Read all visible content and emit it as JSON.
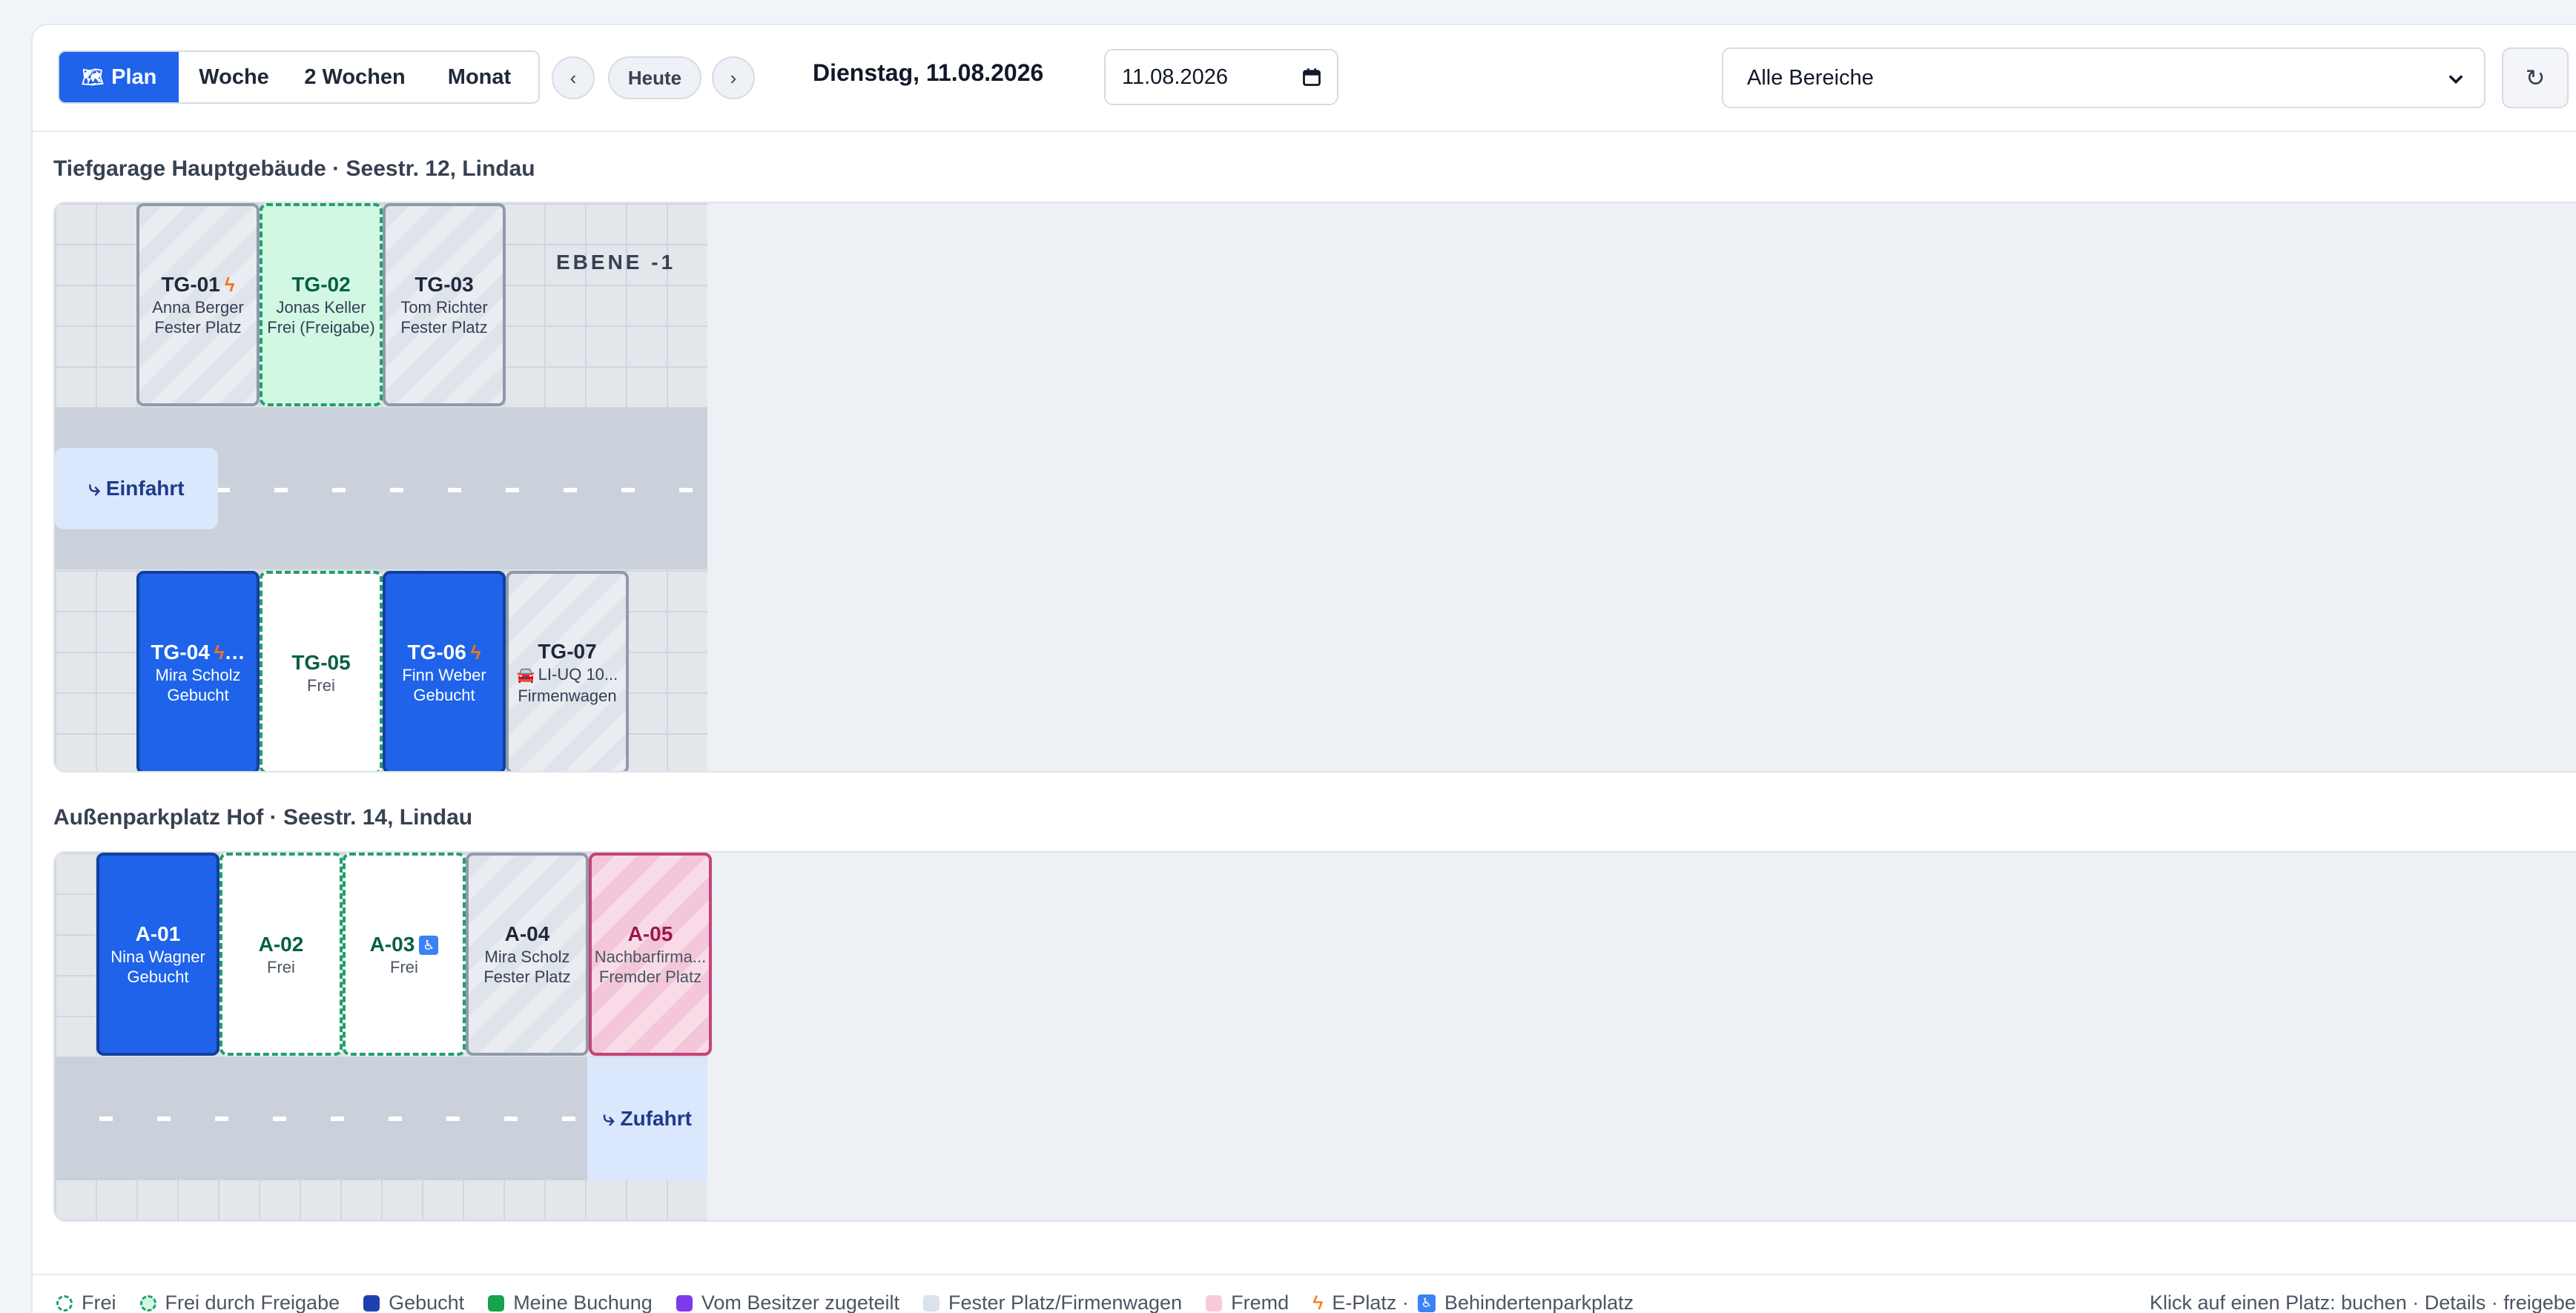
{
  "toolbar": {
    "views": [
      "Plan",
      "Woche",
      "2 Wochen",
      "Monat"
    ],
    "prev_label": "‹",
    "today_label": "Heute",
    "next_label": "›",
    "date_heading": "Dienstag, 11.08.2026",
    "date_value": "11.08.2026",
    "area_filter": "Alle Bereiche",
    "refresh_label": "↻"
  },
  "areas": [
    {
      "title": "Tiefgarage Hauptgebäude · Seestr. 12, Lindau",
      "level": "EBENE -1",
      "gate": "⤷ Einfahrt",
      "spots": [
        {
          "id": "TG-01",
          "line1": "Anna Berger",
          "line2": "Fester Platz",
          "state": "fixed",
          "ev": true
        },
        {
          "id": "TG-02",
          "line1": "Jonas Keller",
          "line2": "Frei (Freigabe)",
          "state": "freigabe"
        },
        {
          "id": "TG-03",
          "line1": "Tom Richter",
          "line2": "Fester Platz",
          "state": "fixed"
        },
        {
          "id": "TG-04",
          "line1": "Mira Scholz",
          "line2": "Gebucht",
          "state": "booked",
          "ev": true,
          "more": "…"
        },
        {
          "id": "TG-05",
          "line1": "Frei",
          "state": "free"
        },
        {
          "id": "TG-06",
          "line1": "Finn Weber",
          "line2": "Gebucht",
          "state": "booked",
          "ev": true
        },
        {
          "id": "TG-07",
          "line1": "LI-UQ 10...",
          "line2": "Firmenwagen",
          "state": "fixed",
          "car": true
        }
      ]
    },
    {
      "title": "Außenparkplatz Hof · Seestr. 14, Lindau",
      "gate": "⤷ Zufahrt",
      "spots": [
        {
          "id": "A-01",
          "line1": "Nina Wagner",
          "line2": "Gebucht",
          "state": "booked"
        },
        {
          "id": "A-02",
          "line1": "Frei",
          "state": "free"
        },
        {
          "id": "A-03",
          "line1": "Frei",
          "state": "free",
          "accessible": true
        },
        {
          "id": "A-04",
          "line1": "Mira Scholz",
          "line2": "Fester Platz",
          "state": "fixed"
        },
        {
          "id": "A-05",
          "line1": "Nachbarfirma...",
          "line2": "Fremder Platz",
          "state": "foreign"
        }
      ]
    }
  ],
  "legend": {
    "items": [
      {
        "label": "Frei",
        "kind": "free"
      },
      {
        "label": "Frei durch Freigabe",
        "kind": "freigabe"
      },
      {
        "label": "Gebucht",
        "kind": "booked"
      },
      {
        "label": "Meine Buchung",
        "kind": "mine"
      },
      {
        "label": "Vom Besitzer zugeteilt",
        "kind": "owner"
      },
      {
        "label": "Fester Platz/Firmenwagen",
        "kind": "fixed"
      },
      {
        "label": "Fremd",
        "kind": "foreign"
      }
    ],
    "ev_label": "E-Platz ·",
    "accessible_label": "Behindertenparkplatz",
    "hint": "Klick auf einen Platz: buchen · Details · freigeben"
  },
  "icons": {
    "plan": "map-icon",
    "ev": "lightning-bolt-icon",
    "accessible": "wheelchair-icon",
    "car": "car-icon",
    "calendar": "calendar-icon",
    "refresh": "refresh-icon"
  },
  "colors": {
    "accent": "#1e63e9",
    "free_border": "#22a06b",
    "freigabe_bg": "#d2f8e4",
    "foreign_border": "#c3437a",
    "ev": "#f97316"
  }
}
